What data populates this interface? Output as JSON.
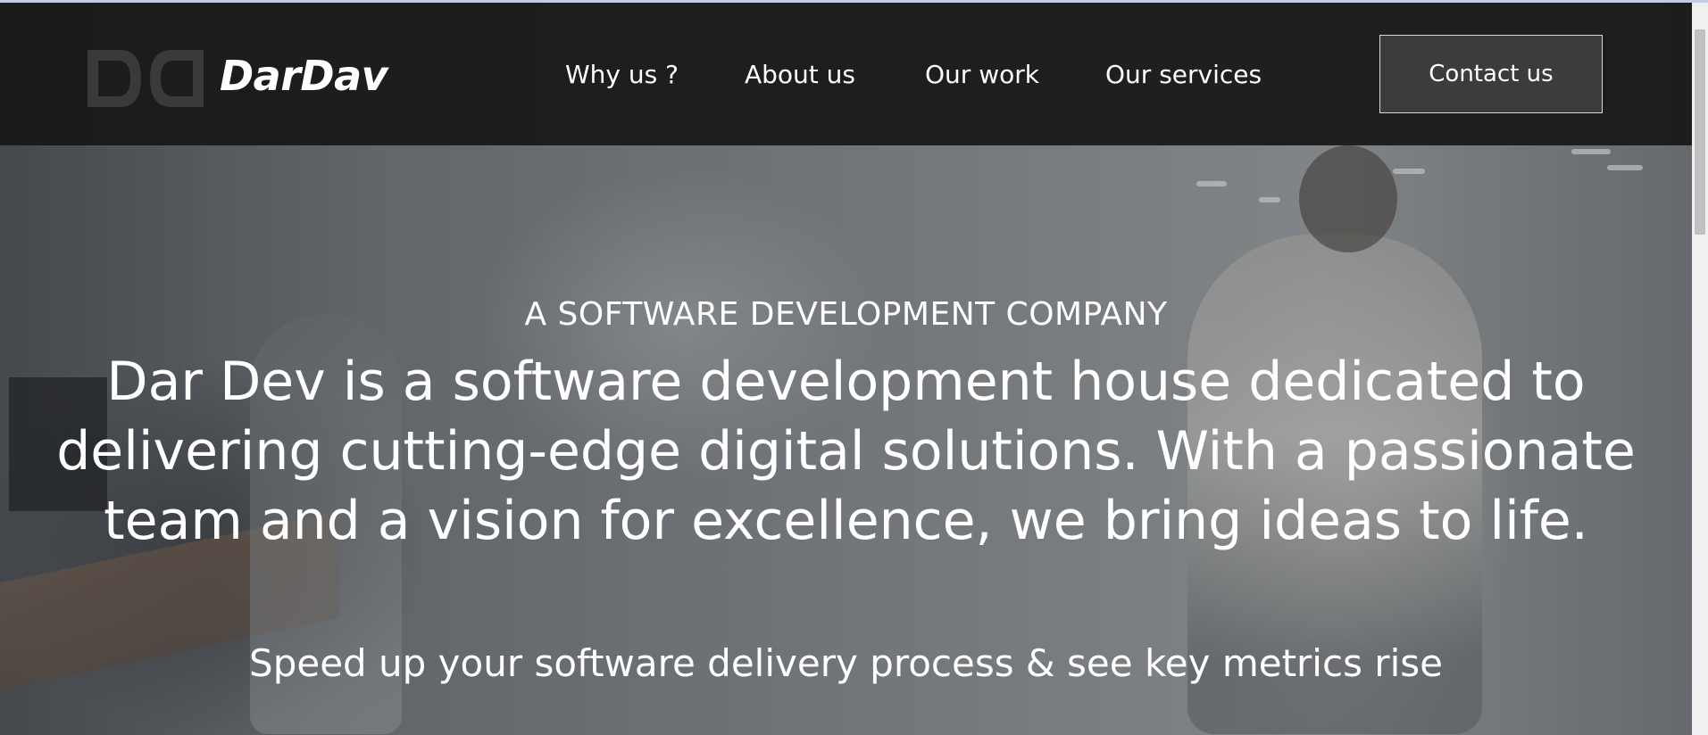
{
  "brand": {
    "name": "DarDav",
    "logo_icon": "dd-monogram-logo"
  },
  "nav": {
    "items": [
      {
        "label": "Why us ?"
      },
      {
        "label": "About us"
      },
      {
        "label": "Our work"
      },
      {
        "label": "Our services"
      }
    ],
    "cta_label": "Contact us"
  },
  "hero": {
    "eyebrow": "A SOFTWARE DEVELOPMENT COMPANY",
    "headline": "Dar Dev is a software development house dedicated to delivering cutting-edge digital solutions. With a passionate team and a vision for excellence, we bring ideas to life.",
    "subline": "Speed up your software delivery process & see key metrics rise",
    "background": "office-video-background"
  },
  "colors": {
    "header_bg": "#181818",
    "text": "#ffffff",
    "cta_bg": "#3c3c3c",
    "cta_border": "#d8d8d8",
    "logo_gray": "#3a3a3a"
  }
}
